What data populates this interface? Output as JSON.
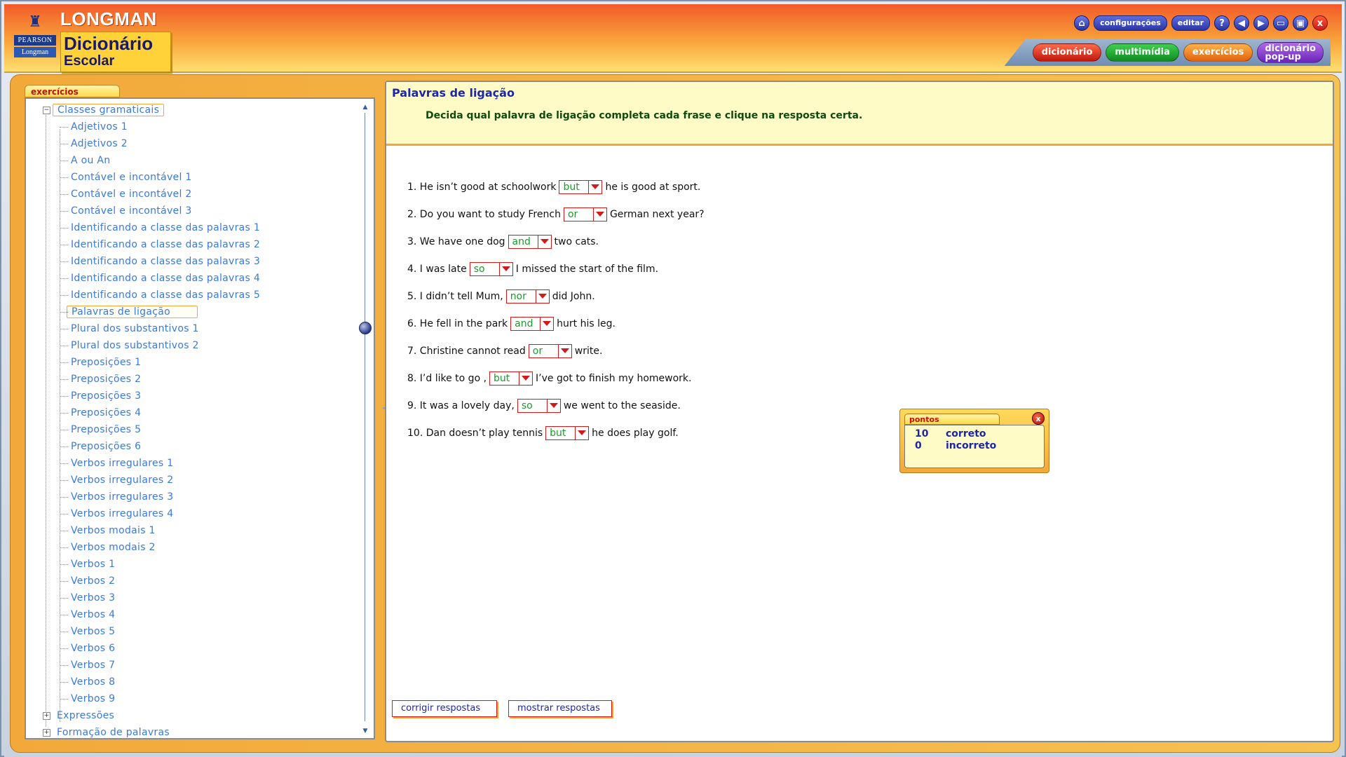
{
  "header": {
    "publisher_line1": "PEARSON",
    "publisher_line2": "Longman",
    "brand": "LONGMAN",
    "product_line1": "Dicionário",
    "product_line2": "Escolar",
    "toolbar": {
      "settings_label": "configurações",
      "edit_label": "editar",
      "help_glyph": "?",
      "close_glyph": "x",
      "icons": [
        "home-icon",
        "help-icon",
        "back-icon",
        "forward-icon",
        "restore-window-icon",
        "maximize-icon",
        "close-icon"
      ]
    },
    "nav_tabs": [
      {
        "label": "dicionário",
        "color": "#d8261a"
      },
      {
        "label": "multimídia",
        "color": "#22a83a"
      },
      {
        "label": "exercícios",
        "color": "#f07a1a"
      },
      {
        "label": "dicionário\npop-up",
        "color": "#8a3ad0"
      }
    ]
  },
  "sidebar": {
    "tab_label": "exercícios",
    "tree": [
      {
        "label": "Classes gramaticais",
        "level": 1,
        "expander": "−",
        "boxed": true
      },
      {
        "label": "Adjetivos 1",
        "level": 2
      },
      {
        "label": "Adjetivos 2",
        "level": 2
      },
      {
        "label": "A ou An",
        "level": 2
      },
      {
        "label": "Contável e incontável 1",
        "level": 2
      },
      {
        "label": "Contável e incontável 2",
        "level": 2
      },
      {
        "label": "Contável e incontável 3",
        "level": 2
      },
      {
        "label": "Identificando a classe das palavras 1",
        "level": 2
      },
      {
        "label": "Identificando a classe das palavras 2",
        "level": 2
      },
      {
        "label": "Identificando a classe das palavras 3",
        "level": 2
      },
      {
        "label": "Identificando a classe das palavras 4",
        "level": 2
      },
      {
        "label": "Identificando a classe das palavras 5",
        "level": 2
      },
      {
        "label": "Palavras de ligação",
        "level": 2,
        "selected": true
      },
      {
        "label": "Plural dos substantivos 1",
        "level": 2
      },
      {
        "label": "Plural dos substantivos 2",
        "level": 2
      },
      {
        "label": "Preposições 1",
        "level": 2
      },
      {
        "label": "Preposições 2",
        "level": 2
      },
      {
        "label": "Preposições 3",
        "level": 2
      },
      {
        "label": "Preposições 4",
        "level": 2
      },
      {
        "label": "Preposições 5",
        "level": 2
      },
      {
        "label": "Preposições 6",
        "level": 2
      },
      {
        "label": "Verbos irregulares 1",
        "level": 2
      },
      {
        "label": "Verbos irregulares 2",
        "level": 2
      },
      {
        "label": "Verbos irregulares 3",
        "level": 2
      },
      {
        "label": "Verbos irregulares 4",
        "level": 2
      },
      {
        "label": "Verbos modais 1",
        "level": 2
      },
      {
        "label": "Verbos modais 2",
        "level": 2
      },
      {
        "label": "Verbos 1",
        "level": 2
      },
      {
        "label": "Verbos 2",
        "level": 2
      },
      {
        "label": "Verbos 3",
        "level": 2
      },
      {
        "label": "Verbos 4",
        "level": 2
      },
      {
        "label": "Verbos 5",
        "level": 2
      },
      {
        "label": "Verbos 6",
        "level": 2
      },
      {
        "label": "Verbos 7",
        "level": 2
      },
      {
        "label": "Verbos 8",
        "level": 2
      },
      {
        "label": "Verbos 9",
        "level": 2
      },
      {
        "label": "Expressões",
        "level": 1,
        "expander": "+"
      },
      {
        "label": "Formação de palavras",
        "level": 1,
        "expander": "+"
      }
    ]
  },
  "exercise": {
    "title": "Palavras de ligação",
    "instruction": "Decida qual palavra de ligação completa cada frase e clique na resposta certa.",
    "questions": [
      {
        "before": "1. He isn’t good at schoolwork",
        "answer": "but",
        "after": "he is good at sport."
      },
      {
        "before": "2. Do you want to study French",
        "answer": "or",
        "after": "German next year?"
      },
      {
        "before": "3. We have one dog",
        "answer": "and",
        "after": "two cats."
      },
      {
        "before": "4. I was late",
        "answer": "so",
        "after": "I missed the start of the film."
      },
      {
        "before": "5. I didn’t tell Mum,",
        "answer": "nor",
        "after": "did John."
      },
      {
        "before": "6. He fell in the park",
        "answer": "and",
        "after": "hurt his leg."
      },
      {
        "before": "7. Christine cannot read",
        "answer": "or",
        "after": "write."
      },
      {
        "before": "8. I’d like to go ,",
        "answer": "but",
        "after": "I’ve got to finish my homework."
      },
      {
        "before": "9. It was a lovely day,",
        "answer": "so",
        "after": "we went to the seaside."
      },
      {
        "before": "10. Dan doesn’t play tennis",
        "answer": "but",
        "after": "he does play golf."
      }
    ],
    "buttons": {
      "check": "corrigir respostas",
      "show": "mostrar respostas"
    }
  },
  "score": {
    "tab_label": "pontos",
    "close_glyph": "x",
    "rows": [
      {
        "count": "10",
        "label": "correto"
      },
      {
        "count": "0",
        "label": "incorreto"
      }
    ]
  }
}
